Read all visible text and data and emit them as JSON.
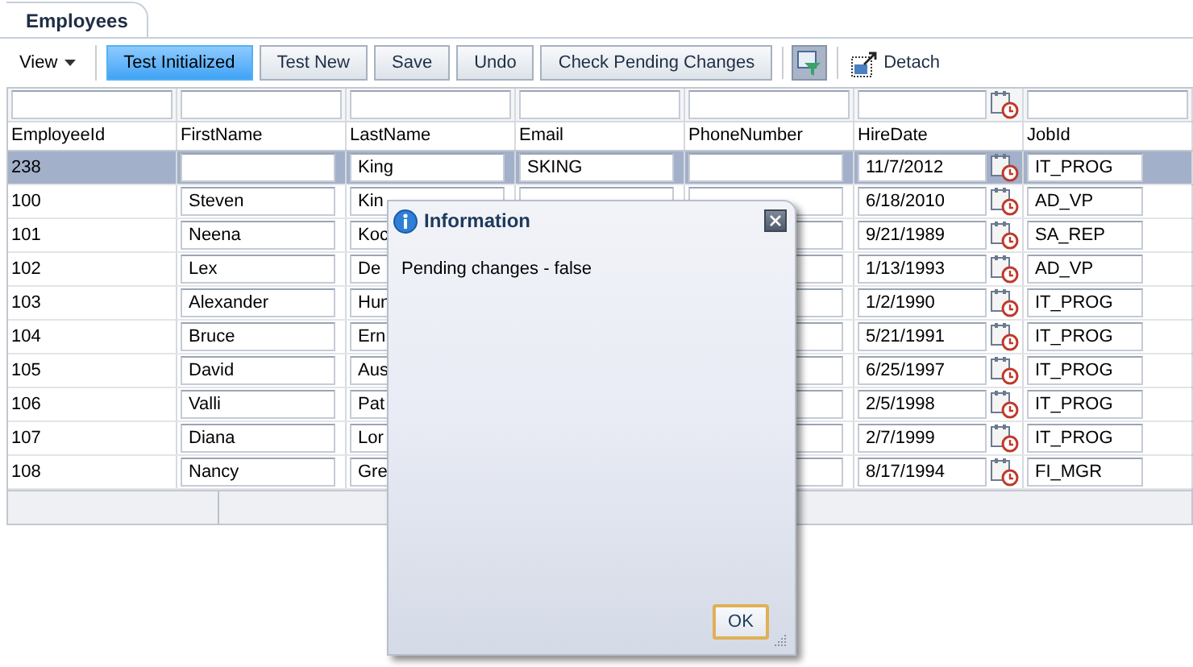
{
  "tab": {
    "label": "Employees"
  },
  "toolbar": {
    "view_menu": "View",
    "buttons": [
      {
        "label": "Test Initialized",
        "selected": true
      },
      {
        "label": "Test New",
        "selected": false
      },
      {
        "label": "Save",
        "selected": false
      },
      {
        "label": "Undo",
        "selected": false
      },
      {
        "label": "Check Pending Changes",
        "selected": false
      }
    ],
    "filter_toggle": {
      "selected": true
    },
    "detach": "Detach"
  },
  "table": {
    "columns": [
      "EmployeeId",
      "FirstName",
      "LastName",
      "Email",
      "PhoneNumber",
      "HireDate",
      "JobId"
    ],
    "rows": [
      {
        "selected": true,
        "employee_id": "238",
        "last_name": "King",
        "email": "SKING",
        "hire_date": "11/7/2012",
        "job_id": "IT_PROG"
      },
      {
        "selected": false,
        "employee_id": "100",
        "first_name": "Steven",
        "last_name": "Kin",
        "hire_date": "6/18/2010",
        "job_id": "AD_VP"
      },
      {
        "selected": false,
        "employee_id": "101",
        "first_name": "Neena",
        "last_name": "Koc",
        "hire_date": "9/21/1989",
        "job_id": "SA_REP"
      },
      {
        "selected": false,
        "employee_id": "102",
        "first_name": "Lex",
        "last_name": "De",
        "hire_date": "1/13/1993",
        "job_id": "AD_VP"
      },
      {
        "selected": false,
        "employee_id": "103",
        "first_name": "Alexander",
        "last_name": "Hun",
        "hire_date": "1/2/1990",
        "job_id": "IT_PROG"
      },
      {
        "selected": false,
        "employee_id": "104",
        "first_name": "Bruce",
        "last_name": "Ern",
        "hire_date": "5/21/1991",
        "job_id": "IT_PROG"
      },
      {
        "selected": false,
        "employee_id": "105",
        "first_name": "David",
        "last_name": "Aus",
        "hire_date": "6/25/1997",
        "job_id": "IT_PROG"
      },
      {
        "selected": false,
        "employee_id": "106",
        "first_name": "Valli",
        "last_name": "Pat",
        "hire_date": "2/5/1998",
        "job_id": "IT_PROG"
      },
      {
        "selected": false,
        "employee_id": "107",
        "first_name": "Diana",
        "last_name": "Lor",
        "hire_date": "2/7/1999",
        "job_id": "IT_PROG"
      },
      {
        "selected": false,
        "employee_id": "108",
        "first_name": "Nancy",
        "last_name": "Gre",
        "hire_date": "8/17/1994",
        "job_id": "FI_MGR"
      }
    ]
  },
  "dialog": {
    "title": "Information",
    "message": "Pending changes - false",
    "ok": "OK"
  }
}
